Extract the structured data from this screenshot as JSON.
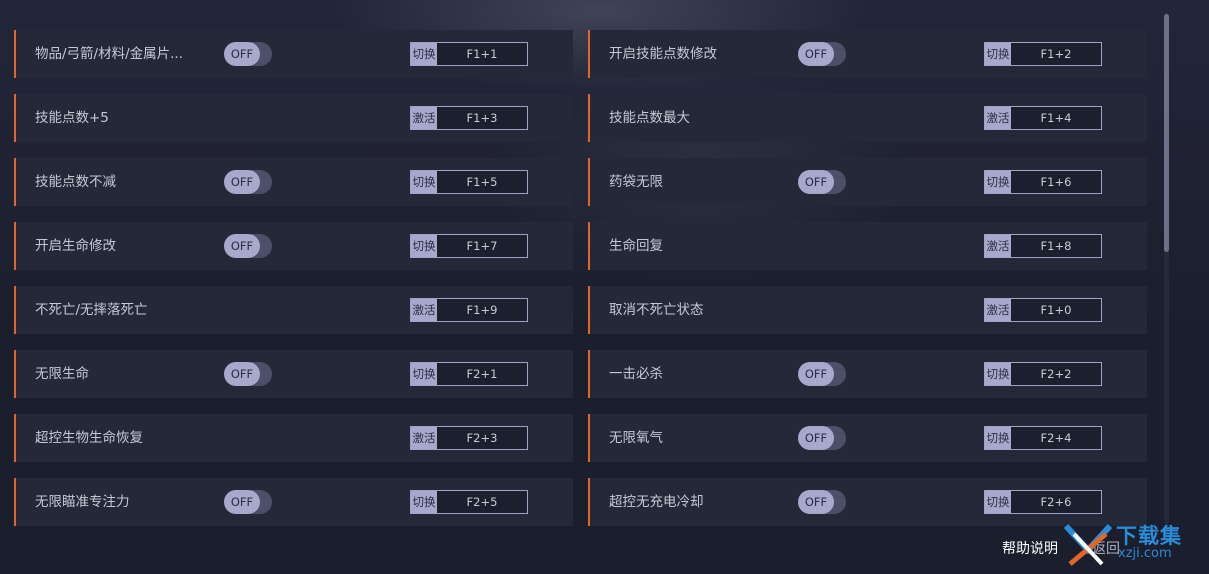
{
  "cheats": [
    {
      "label": "物品/弓箭/材料/金属片...",
      "toggle": "OFF",
      "mode": "切换",
      "hotkey": "F1+1"
    },
    {
      "label": "开启技能点数修改",
      "toggle": "OFF",
      "mode": "切换",
      "hotkey": "F1+2"
    },
    {
      "label": "技能点数+5",
      "toggle": null,
      "mode": "激活",
      "hotkey": "F1+3"
    },
    {
      "label": "技能点数最大",
      "toggle": null,
      "mode": "激活",
      "hotkey": "F1+4"
    },
    {
      "label": "技能点数不减",
      "toggle": "OFF",
      "mode": "切换",
      "hotkey": "F1+5"
    },
    {
      "label": "药袋无限",
      "toggle": "OFF",
      "mode": "切换",
      "hotkey": "F1+6"
    },
    {
      "label": "开启生命修改",
      "toggle": "OFF",
      "mode": "切换",
      "hotkey": "F1+7"
    },
    {
      "label": "生命回复",
      "toggle": null,
      "mode": "激活",
      "hotkey": "F1+8"
    },
    {
      "label": "不死亡/无摔落死亡",
      "toggle": null,
      "mode": "激活",
      "hotkey": "F1+9"
    },
    {
      "label": "取消不死亡状态",
      "toggle": null,
      "mode": "激活",
      "hotkey": "F1+0"
    },
    {
      "label": "无限生命",
      "toggle": "OFF",
      "mode": "切换",
      "hotkey": "F2+1"
    },
    {
      "label": "一击必杀",
      "toggle": "OFF",
      "mode": "切换",
      "hotkey": "F2+2"
    },
    {
      "label": "超控生物生命恢复",
      "toggle": null,
      "mode": "激活",
      "hotkey": "F2+3"
    },
    {
      "label": "无限氧气",
      "toggle": "OFF",
      "mode": "切换",
      "hotkey": "F2+4"
    },
    {
      "label": "无限瞄准专注力",
      "toggle": "OFF",
      "mode": "切换",
      "hotkey": "F2+5"
    },
    {
      "label": "超控无充电冷却",
      "toggle": "OFF",
      "mode": "切换",
      "hotkey": "F2+6"
    }
  ],
  "footer": {
    "help_label": "帮助说明",
    "back_label": "返回"
  },
  "watermark": {
    "text": "下载集",
    "url": "xzji.com"
  },
  "colors": {
    "accent": "#e0662a",
    "row_bg": "#252839",
    "badge": "#a6a9cc",
    "watermark": "#2a8bd8"
  }
}
